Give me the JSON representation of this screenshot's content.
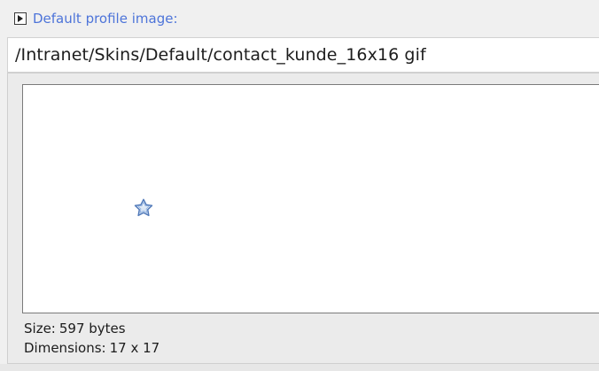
{
  "header": {
    "label": "Default profile image:",
    "toggle_icon": "triangle-right-icon"
  },
  "path_field": {
    "value": "/Intranet/Skins/Default/contact_kunde_16x16 gif"
  },
  "preview": {
    "icon_name": "star-icon",
    "size_label": "Size:",
    "size_value": "597 bytes",
    "dimensions_label": "Dimensions:",
    "dimensions_value": "17 x 17"
  },
  "colors": {
    "header_label": "#4d74d9",
    "preview_background": "#ffffff",
    "panel_background": "#ebebeb",
    "page_background": "#f0f0f0"
  }
}
